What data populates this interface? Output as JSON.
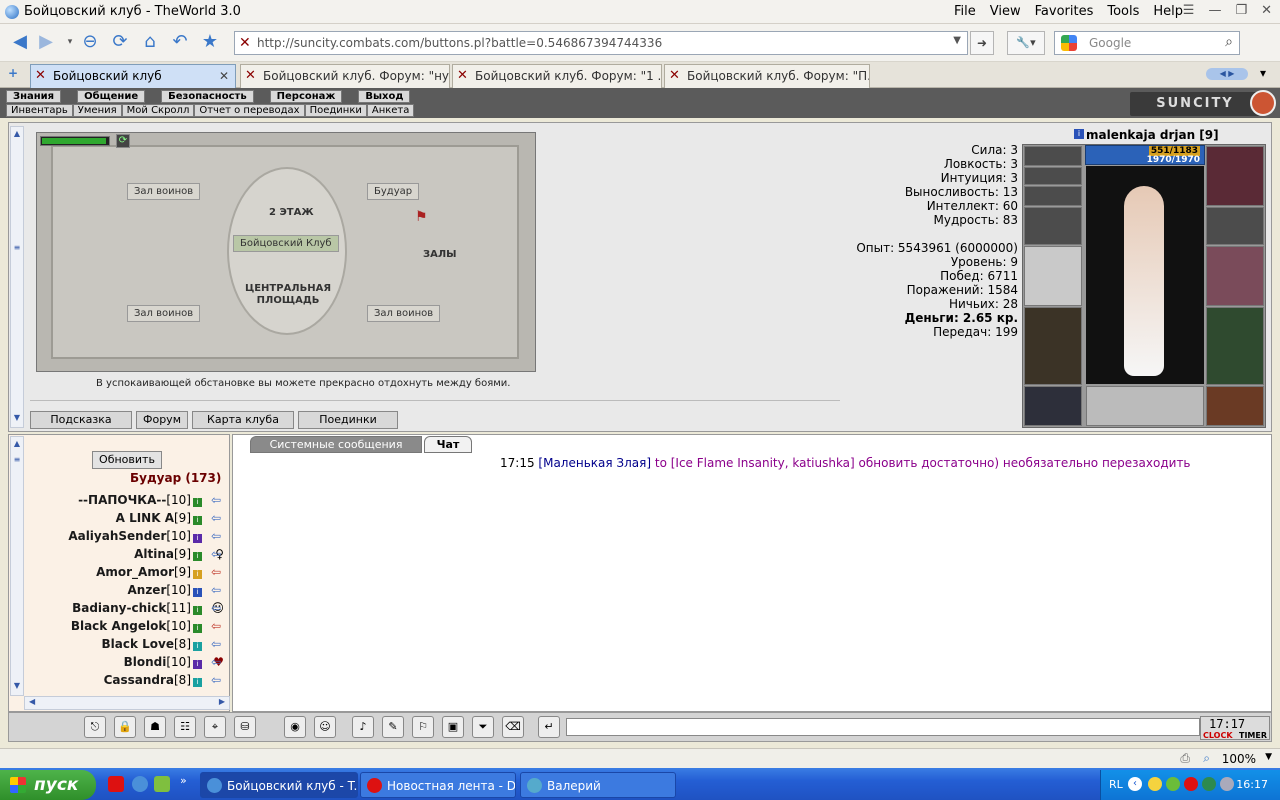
{
  "window": {
    "title": "Бойцовский клуб - TheWorld 3.0",
    "menus": [
      "File",
      "View",
      "Favorites",
      "Tools",
      "Help"
    ]
  },
  "address": {
    "url": "http://suncity.combats.com/buttons.pl?battle=0.546867394744336",
    "search_placeholder": "Google"
  },
  "tabs": [
    {
      "label": "Бойцовский клуб",
      "active": true
    },
    {
      "label": "Бойцовский клуб. Форум: \"ну...",
      "active": false
    },
    {
      "label": "Бойцовский клуб. Форум: \"1 ...",
      "active": false
    },
    {
      "label": "Бойцовский клуб. Форум: \"П...",
      "active": false
    }
  ],
  "game_nav": {
    "row1": [
      "Знания",
      "Общение",
      "Безопасность",
      "Персонаж",
      "Выход"
    ],
    "row2": [
      "Инвентарь",
      "Умения",
      "Мой Скролл",
      "Отчет о переводах",
      "Поединки",
      "Анкета"
    ],
    "logo": "SUNCITY"
  },
  "map": {
    "labels": {
      "floor": "2 ЭТАЖ",
      "halls": "ЗАЛЫ",
      "square": "ЦЕНТРАЛЬНАЯ ПЛОЩАДЬ",
      "club": "Бойцовский Клуб"
    },
    "buttons": [
      "Зал воинов",
      "Будуар",
      "Зал воинов",
      "Зал воинов"
    ],
    "tip": "В успокаивающей обстановке вы можете прекрасно отдохнуть между боями.",
    "bottom_buttons": [
      "Поединки",
      "Карта клуба",
      "Форум",
      "Подсказка"
    ]
  },
  "character": {
    "name": "malenkaja drjan [9]",
    "hp": "551/1183",
    "mana": "1970/1970",
    "stats": [
      "Сила: 3",
      "Ловкость: 3",
      "Интуиция: 3",
      "Выносливость: 13",
      "Интеллект: 60",
      "Мудрость: 83"
    ],
    "info": [
      "Опыт: 5543961 (6000000)",
      "Уровень: 9",
      "Побед: 6711",
      "Поражений: 1584",
      "Ничьих: 28",
      "Деньги: 2.65 кр.",
      "Передач: 199"
    ]
  },
  "room": {
    "refresh": "Обновить",
    "title": "Будуар (173)",
    "users": [
      {
        "name": "--ПАПОЧКА--",
        "level": "[10]"
      },
      {
        "name": "A LINK A",
        "level": "[9]"
      },
      {
        "name": "AaliyahSender",
        "level": "[10]"
      },
      {
        "name": "Altina",
        "level": "[9]"
      },
      {
        "name": "Amor_Amor",
        "level": "[9]"
      },
      {
        "name": "Anzer",
        "level": "[10]"
      },
      {
        "name": "Badiany-chick",
        "level": "[11]"
      },
      {
        "name": "Black Angelok",
        "level": "[10]"
      },
      {
        "name": "Black Love",
        "level": "[8]"
      },
      {
        "name": "Blondi",
        "level": "[10]"
      },
      {
        "name": "Cassandra",
        "level": "[8]"
      }
    ]
  },
  "chat": {
    "tabs": [
      "Системные сообщения",
      "Чат"
    ],
    "message": {
      "time": "17:15",
      "nick": "[Маленькая Злая]",
      "text": "to [Ice Flame Insanity, katiushka] обновить достаточно) необязательно перезаходить"
    }
  },
  "clock": {
    "digits": "17:17",
    "label1": "CLOCK",
    "label2": "TIMER"
  },
  "status": {
    "zoom": "100%"
  },
  "taskbar": {
    "start": "пуск",
    "tasks": [
      "Бойцовский клуб - T...",
      "Новостная лента - D...",
      "Валерий"
    ],
    "lang": "RL",
    "time": "16:17"
  }
}
